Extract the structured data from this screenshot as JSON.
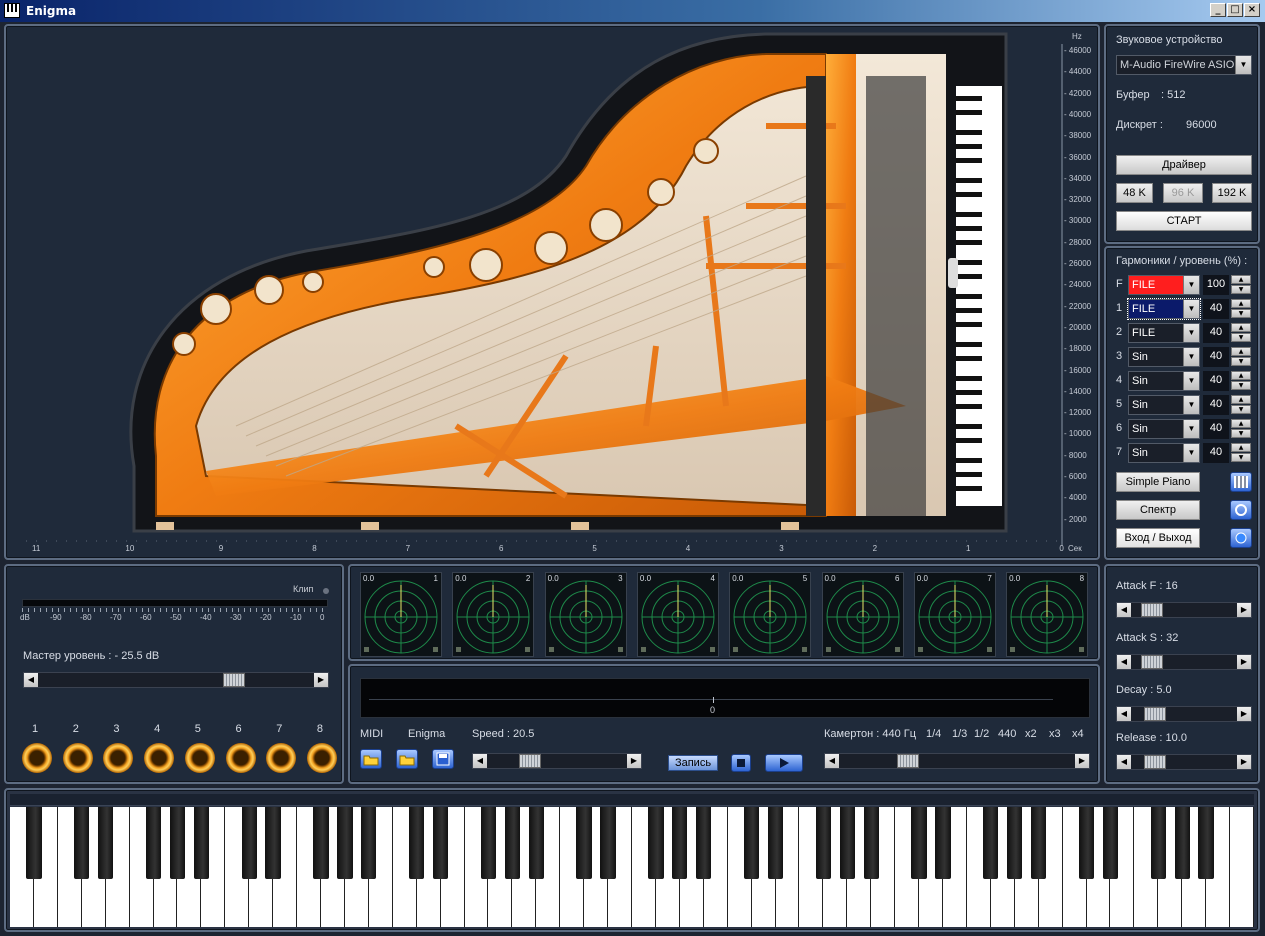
{
  "window": {
    "title": "Enigma",
    "min": "_",
    "max": "□",
    "close": "×"
  },
  "colors": {
    "accent_orange": "#f08a1c",
    "panel_bg": "#1f2a3a",
    "border": "#5d6c82",
    "file_red": "#ff1e1e",
    "scope_green": "#1e8a4a"
  },
  "freq_axis": {
    "unit": "Hz",
    "ticks": [
      "46000",
      "44000",
      "42000",
      "40000",
      "38000",
      "36000",
      "34000",
      "32000",
      "30000",
      "28000",
      "26000",
      "24000",
      "22000",
      "20000",
      "18000",
      "16000",
      "14000",
      "12000",
      "10000",
      "8000",
      "6000",
      "4000",
      "2000"
    ]
  },
  "time_axis": {
    "unit": "Сек",
    "ticks": [
      "11",
      "10",
      "9",
      "8",
      "7",
      "6",
      "5",
      "4",
      "3",
      "2",
      "1",
      "0"
    ]
  },
  "device": {
    "label": "Звуковое устройство",
    "selected": "M-Audio FireWire ASIO",
    "buffer_label": "Буфер",
    "buffer_value": ":   512",
    "rate_label": "Дискрет :",
    "rate_value": "96000",
    "driver_button": "Драйвер",
    "rates": [
      "48 K",
      "96 K",
      "192 K"
    ],
    "start_button": "СТАРТ"
  },
  "harmonics": {
    "header": "Гармоники / уровень (%) :",
    "rows": [
      {
        "index": "F",
        "source": "FILE",
        "level": "100"
      },
      {
        "index": "1",
        "source": "FILE",
        "level": "40"
      },
      {
        "index": "2",
        "source": "FILE",
        "level": "40"
      },
      {
        "index": "3",
        "source": "Sin",
        "level": "40"
      },
      {
        "index": "4",
        "source": "Sin",
        "level": "40"
      },
      {
        "index": "5",
        "source": "Sin",
        "level": "40"
      },
      {
        "index": "6",
        "source": "Sin",
        "level": "40"
      },
      {
        "index": "7",
        "source": "Sin",
        "level": "40"
      }
    ],
    "simple_piano": "Simple Piano",
    "spectrum": "Спектр",
    "io": "Вход / Выход"
  },
  "master": {
    "clip_label": "Клип",
    "db_scale": [
      "dB",
      "-90",
      "-80",
      "-70",
      "-60",
      "-50",
      "-40",
      "-30",
      "-20",
      "-10",
      "0"
    ],
    "level_label": "Мастер уровень : - 25.5 dB",
    "level_position": 0.73,
    "channels": [
      "1",
      "2",
      "3",
      "4",
      "5",
      "6",
      "7",
      "8"
    ]
  },
  "scopes": [
    {
      "value": "0.0",
      "num": "1"
    },
    {
      "value": "0.0",
      "num": "2"
    },
    {
      "value": "0.0",
      "num": "3"
    },
    {
      "value": "0.0",
      "num": "4"
    },
    {
      "value": "0.0",
      "num": "5"
    },
    {
      "value": "0.0",
      "num": "6"
    },
    {
      "value": "0.0",
      "num": "7"
    },
    {
      "value": "0.0",
      "num": "8"
    }
  ],
  "transport": {
    "timeline_value": "0",
    "midi_label": "MIDI",
    "enigma_label": "Enigma",
    "speed_label": "Speed : 20.5",
    "speed_position": 0.27,
    "record_button": "Запись",
    "tuning_label": "Камертон : 440 Гц",
    "tuning_marks": [
      "1/4",
      "1/3",
      "1/2",
      "440",
      "x2",
      "x3",
      "x4"
    ],
    "tuning_position": 0.27
  },
  "envelope": {
    "attack_f": {
      "label": "Attack F : 16",
      "position": 0.12
    },
    "attack_s": {
      "label": "Attack S : 32",
      "position": 0.12
    },
    "decay": {
      "label": "Decay : 5.0",
      "position": 0.15
    },
    "release": {
      "label": "Release : 10.0",
      "position": 0.15
    }
  }
}
